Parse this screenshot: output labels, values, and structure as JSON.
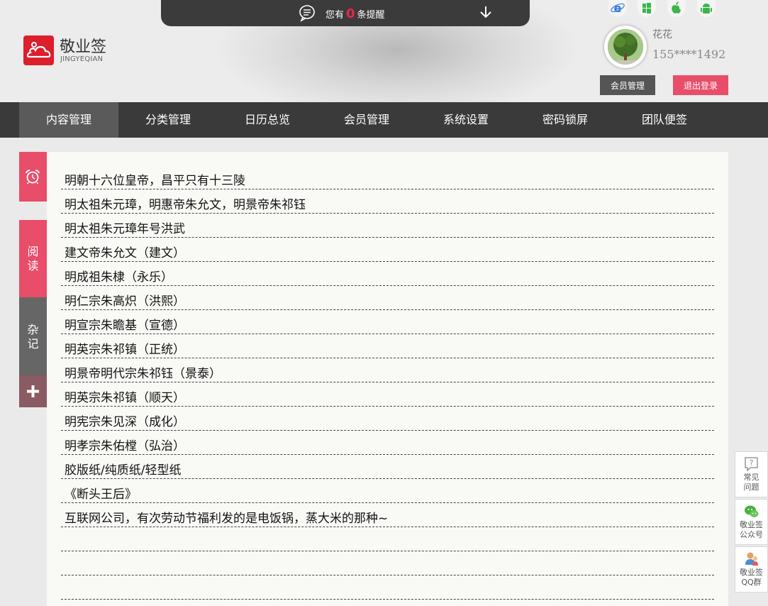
{
  "reminder": {
    "prefix": "您有",
    "count": "0",
    "suffix": "条提醒"
  },
  "logo": {
    "name": "敬业签",
    "sub": "JINGYEQIAN"
  },
  "platforms": [
    "ie-icon",
    "windows-icon",
    "apple-icon",
    "android-icon"
  ],
  "user": {
    "name": "花花",
    "phone": "155****1492"
  },
  "buttons": {
    "member": "会员管理",
    "logout": "退出登录"
  },
  "nav": [
    "内容管理",
    "分类管理",
    "日历总览",
    "会员管理",
    "系统设置",
    "密码锁屏",
    "团队便签"
  ],
  "side": {
    "read": [
      "阅",
      "读"
    ],
    "misc": [
      "杂",
      "记"
    ]
  },
  "notes": [
    "明朝十六位皇帝，昌平只有十三陵",
    "明太祖朱元璋，明惠帝朱允文，明景帝朱祁钰",
    "明太祖朱元璋年号洪武",
    "建文帝朱允文（建文）",
    "明成祖朱棣（永乐）",
    "明仁宗朱高炽（洪熙）",
    "明宣宗朱瞻基（宣德）",
    "明英宗朱祁镇（正统）",
    "明景帝明代宗朱祁钰（景泰）",
    "明英宗朱祁镇（顺天）",
    "明宪宗朱见深（成化）",
    "明孝宗朱佑樘（弘治）",
    "胶版纸/纯质纸/轻型纸",
    "《断头王后》",
    "互联网公司，有次劳动节福利发的是电饭锅，蒸大米的那种~",
    "",
    "",
    ""
  ],
  "widgets": [
    {
      "icon": "question-icon",
      "label1": "常见",
      "label2": "问题"
    },
    {
      "icon": "wechat-icon",
      "label1": "敬业签",
      "label2": "公众号"
    },
    {
      "icon": "qq-icon",
      "label1": "敬业签",
      "label2": "QQ群"
    }
  ],
  "colors": {
    "accent": "#e84d6a",
    "nav": "#3a3a3a",
    "logo": "#dd1e2b"
  }
}
